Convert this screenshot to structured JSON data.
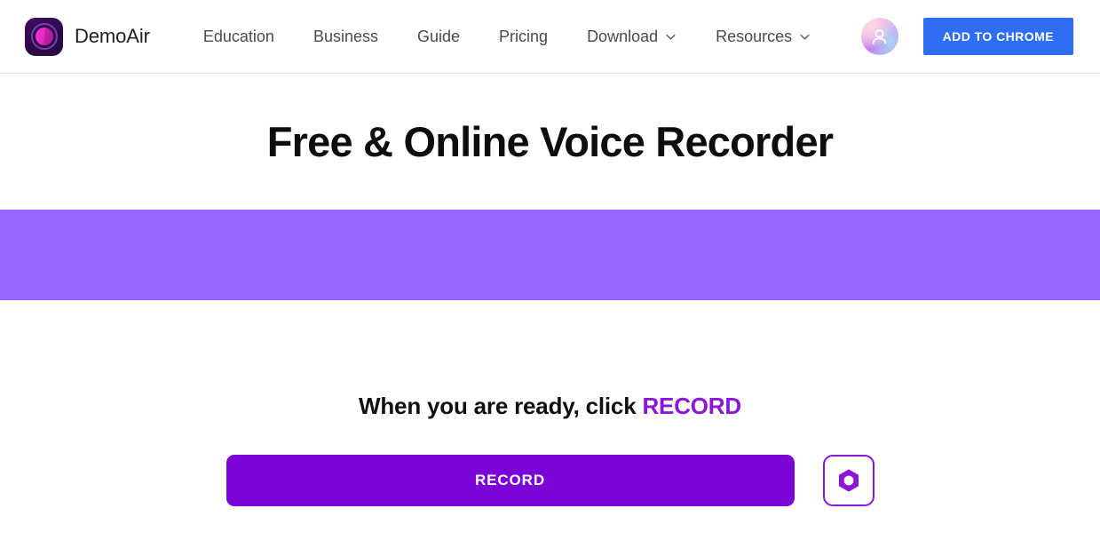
{
  "header": {
    "brand": {
      "name": "DemoAir",
      "logo_icon": "demoair-logo-icon"
    },
    "nav": [
      {
        "label": "Education",
        "has_dropdown": false
      },
      {
        "label": "Business",
        "has_dropdown": false
      },
      {
        "label": "Guide",
        "has_dropdown": false
      },
      {
        "label": "Pricing",
        "has_dropdown": false
      },
      {
        "label": "Download",
        "has_dropdown": true
      },
      {
        "label": "Resources",
        "has_dropdown": true
      }
    ],
    "avatar_icon": "user-avatar-icon",
    "cta_label": "ADD TO CHROME"
  },
  "hero": {
    "title": "Free & Online Voice Recorder"
  },
  "banner": {
    "color": "#9466fc"
  },
  "main": {
    "ready_prefix": "When you are ready, click ",
    "ready_accent": "RECORD",
    "record_label": "RECORD",
    "settings_icon": "settings-hex-icon"
  },
  "colors": {
    "brand_purple": "#8b16d9",
    "record_purple": "#7b05d8",
    "banner_purple": "#9466fc",
    "chrome_blue": "#2d6ef2",
    "text_dark": "#0d0d0d",
    "nav_gray": "#4a4a4f"
  }
}
